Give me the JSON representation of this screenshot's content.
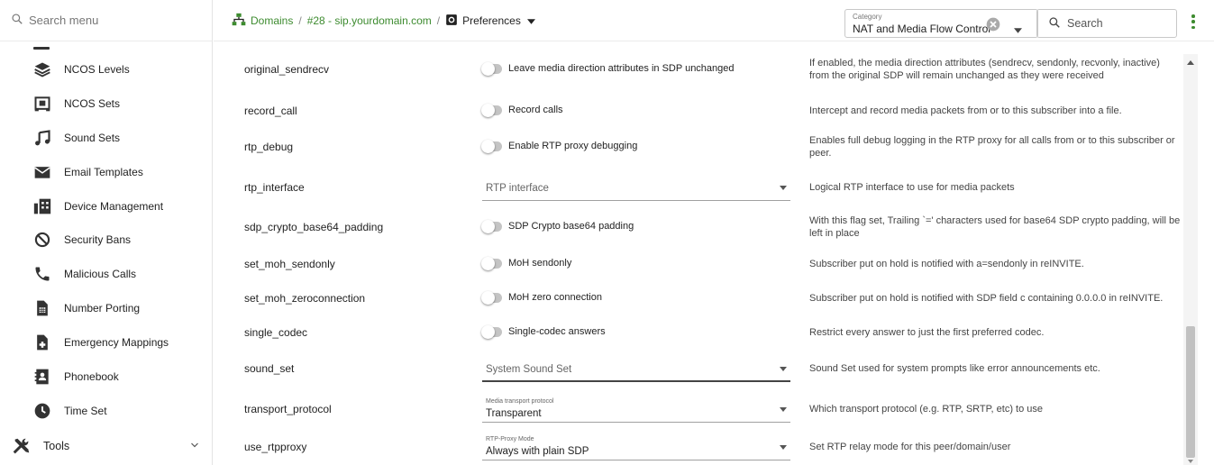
{
  "sidebar": {
    "search_placeholder": "Search menu",
    "items": [
      {
        "label": "NCOS Levels",
        "icon": "layers-icon"
      },
      {
        "label": "NCOS Sets",
        "icon": "ncos-sets-icon"
      },
      {
        "label": "Sound Sets",
        "icon": "music-note-icon"
      },
      {
        "label": "Email Templates",
        "icon": "envelope-icon"
      },
      {
        "label": "Device Management",
        "icon": "device-management-icon"
      },
      {
        "label": "Security Bans",
        "icon": "ban-icon"
      },
      {
        "label": "Malicious Calls",
        "icon": "phone-icon"
      },
      {
        "label": "Number Porting",
        "icon": "sim-card-icon"
      },
      {
        "label": "Emergency Mappings",
        "icon": "medical-file-icon"
      },
      {
        "label": "Phonebook",
        "icon": "contact-book-icon"
      },
      {
        "label": "Time Set",
        "icon": "clock-icon"
      }
    ],
    "tools_label": "Tools"
  },
  "header": {
    "breadcrumb": {
      "domains": "Domains",
      "sep1": "/",
      "domain": "#28 - sip.yourdomain.com",
      "sep2": "/",
      "current": "Preferences"
    },
    "category": {
      "label": "Category",
      "value": "NAT and Media Flow Control"
    },
    "search_placeholder": "Search",
    "accent_color": "#3d8b2f"
  },
  "rows": [
    {
      "name": "original_sendrecv",
      "control": "toggle",
      "label": "Leave media direction attributes in SDP unchanged",
      "value": false,
      "description": "If enabled, the media direction attributes (sendrecv, sendonly, recvonly, inactive) from the original SDP will remain unchanged as they were received"
    },
    {
      "name": "record_call",
      "control": "toggle",
      "label": "Record calls",
      "value": false,
      "description": "Intercept and record media packets from or to this subscriber into a file."
    },
    {
      "name": "rtp_debug",
      "control": "toggle",
      "label": "Enable RTP proxy debugging",
      "value": false,
      "description": "Enables full debug logging in the RTP proxy for all calls from or to this subscriber or peer."
    },
    {
      "name": "rtp_interface",
      "control": "select",
      "placeholder": "RTP interface",
      "description": "Logical RTP interface to use for media packets"
    },
    {
      "name": "sdp_crypto_base64_padding",
      "control": "toggle",
      "label": "SDP Crypto base64 padding",
      "value": false,
      "description": "With this flag set, Trailing `=' characters used for base64 SDP crypto padding, will be left in place"
    },
    {
      "name": "set_moh_sendonly",
      "control": "toggle",
      "label": "MoH sendonly",
      "value": false,
      "description": "Subscriber put on hold is notified with a=sendonly in reINVITE."
    },
    {
      "name": "set_moh_zeroconnection",
      "control": "toggle",
      "label": "MoH zero connection",
      "value": false,
      "description": "Subscriber put on hold is notified with SDP field c containing 0.0.0.0 in reINVITE."
    },
    {
      "name": "single_codec",
      "control": "toggle",
      "label": "Single-codec answers",
      "value": false,
      "description": "Restrict every answer to just the first preferred codec."
    },
    {
      "name": "sound_set",
      "control": "select",
      "placeholder": "System Sound Set",
      "active": true,
      "description": "Sound Set used for system prompts like error announcements etc."
    },
    {
      "name": "transport_protocol",
      "control": "select",
      "field_label": "Media transport protocol",
      "value": "Transparent",
      "description": "Which transport protocol (e.g. RTP, SRTP, etc) to use"
    },
    {
      "name": "use_rtpproxy",
      "control": "select",
      "field_label": "RTP-Proxy Mode",
      "value": "Always with plain SDP",
      "description": "Set RTP relay mode for this peer/domain/user"
    }
  ]
}
